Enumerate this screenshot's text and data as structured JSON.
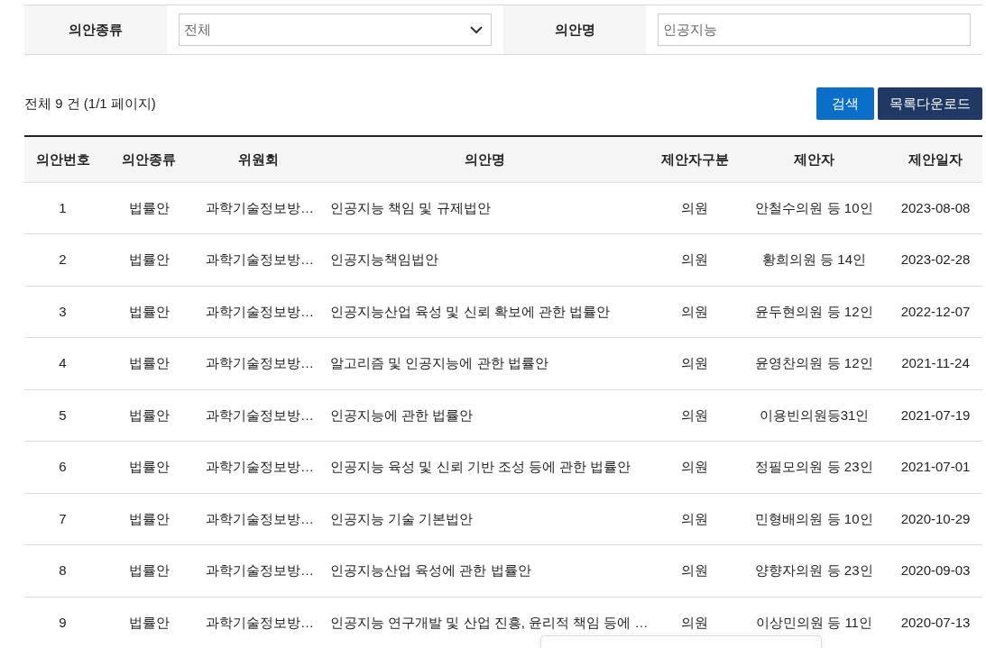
{
  "search_form": {
    "fields": [
      {
        "kind": "select",
        "label": "의안종류",
        "value": "전체"
      },
      {
        "kind": "text",
        "label": "의안명",
        "value": "인공지능"
      }
    ]
  },
  "summary": "전체 9 건 (1/1 페이지)",
  "buttons": [
    {
      "kind": "primary",
      "label": "검색"
    },
    {
      "kind": "secondary",
      "label": "목록다운로드"
    }
  ],
  "table": {
    "columns": [
      "의안번호",
      "의안종류",
      "위원회",
      "의안명",
      "제안자구분",
      "제안자",
      "제안일자"
    ],
    "rows": [
      [
        "1",
        "법률안",
        "과학기술정보방…",
        "인공지능 책임 및 규제법안",
        "의원",
        "안철수의원 등 10인",
        "2023-08-08"
      ],
      [
        "2",
        "법률안",
        "과학기술정보방…",
        "인공지능책임법안",
        "의원",
        "황희의원 등 14인",
        "2023-02-28"
      ],
      [
        "3",
        "법률안",
        "과학기술정보방…",
        "인공지능산업 육성 및 신뢰 확보에 관한 법률안",
        "의원",
        "윤두현의원 등 12인",
        "2022-12-07"
      ],
      [
        "4",
        "법률안",
        "과학기술정보방…",
        "알고리즘 및 인공지능에 관한 법률안",
        "의원",
        "윤영찬의원 등 12인",
        "2021-11-24"
      ],
      [
        "5",
        "법률안",
        "과학기술정보방…",
        "인공지능에 관한 법률안",
        "의원",
        "이용빈의원등31인",
        "2021-07-19"
      ],
      [
        "6",
        "법률안",
        "과학기술정보방…",
        "인공지능 육성 및 신뢰 기반 조성 등에 관한 법률안",
        "의원",
        "정필모의원 등 23인",
        "2021-07-01"
      ],
      [
        "7",
        "법률안",
        "과학기술정보방…",
        "인공지능 기술 기본법안",
        "의원",
        "민형배의원 등 10인",
        "2020-10-29"
      ],
      [
        "8",
        "법률안",
        "과학기술정보방…",
        "인공지능산업 육성에 관한 법률안",
        "의원",
        "양향자의원 등 23인",
        "2020-09-03"
      ],
      [
        "9",
        "법률안",
        "과학기술정보방…",
        "인공지능 연구개발 및 산업 진흥, 윤리적 책임 등에 …",
        "의원",
        "이상민의원 등 11인",
        "2020-07-13"
      ]
    ]
  }
}
